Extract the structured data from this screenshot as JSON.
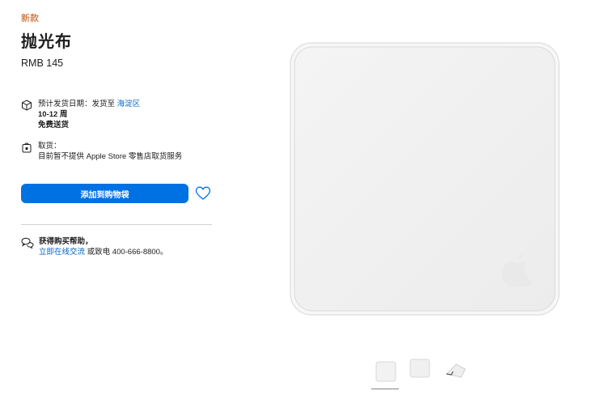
{
  "product": {
    "badge": "新款",
    "title": "抛光布",
    "price": "RMB 145"
  },
  "shipping": {
    "label_prefix": "预计发货日期：发货至",
    "location_link": "海淀区",
    "time": "10-12 周",
    "free": "免费送货"
  },
  "pickup": {
    "label": "取货：",
    "detail": "目前暂不提供 Apple Store 零售店取货服务"
  },
  "actions": {
    "add_to_bag": "添加到购物袋"
  },
  "help": {
    "title": "获得购买帮助，",
    "chat_link": "立即在线交流",
    "call_text": "或致电 400-666-8800。"
  },
  "icons": [
    "box-icon",
    "store-bag-icon",
    "heart-icon",
    "chat-icon"
  ],
  "colors": {
    "accent": "#0071e3",
    "link": "#0066cc",
    "badge": "#bf4800"
  }
}
